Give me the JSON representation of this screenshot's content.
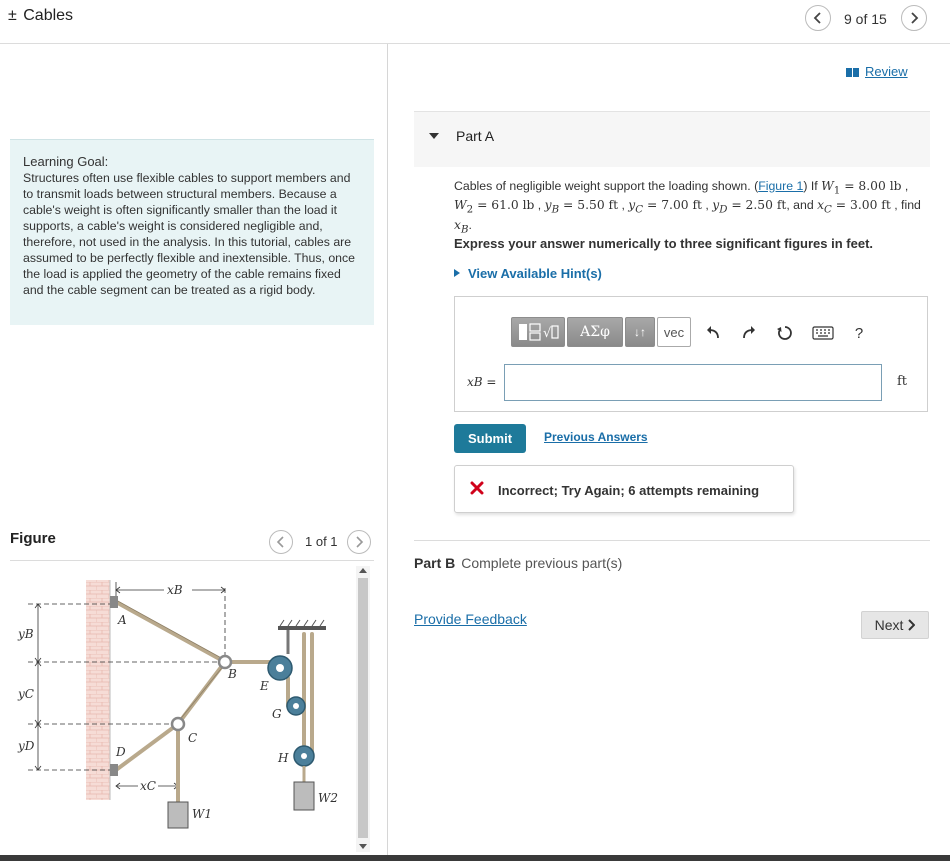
{
  "header": {
    "title_prefix": "±",
    "title": "Cables",
    "page_count": "9 of 15"
  },
  "review": {
    "label": "Review"
  },
  "learning_goal": {
    "heading": "Learning Goal:",
    "text": "Structures often use flexible cables to support members and to transmit loads between structural members. Because a cable's weight is often significantly smaller than the load it supports, a cable's weight is considered negligible and, therefore, not used in the analysis. In this tutorial, cables are assumed to be perfectly flexible and inextensible. Thus, once the load is applied the geometry of the cable remains fixed and the cable segment can be treated as a rigid body."
  },
  "figure": {
    "label": "Figure",
    "count": "1 of 1",
    "labels": {
      "A": "A",
      "B": "B",
      "C": "C",
      "D": "D",
      "E": "E",
      "G": "G",
      "H": "H",
      "xB": "xB",
      "xC": "xC",
      "yB": "yB",
      "yC": "yC",
      "yD": "yD",
      "W1": "W1",
      "W2": "W2"
    }
  },
  "partA": {
    "label": "Part A",
    "question": {
      "pre": "Cables of negligible weight support the loading shown. (",
      "link": "Figure 1",
      "post": ") If",
      "w1_sym": "W",
      "w1_sub": "1",
      "w1_val": " = 8.00 lb",
      "w2_sym": "W",
      "w2_sub": "2",
      "w2_val": " = 61.0 lb",
      "yb_sym": "y",
      "yb_sub": "B",
      "yb_val": " = 5.50 ft",
      "yc_sym": "y",
      "yc_sub": "C",
      "yc_val": " = 7.00 ft",
      "yd_sym": "y",
      "yd_sub": "D",
      "yd_val": " = 2.50 ft",
      "and": ", and",
      "xc_sym": "x",
      "xc_sub": "C",
      "xc_val": " = 3.00 ft",
      "find": "find",
      "xb_sym": "x",
      "xb_sub": "B",
      "end": "."
    },
    "instruction": "Express your answer numerically to three significant figures in feet.",
    "hints": "View Available Hint(s)",
    "toolbar": {
      "sqrt": "√",
      "greek": "ΑΣφ",
      "arrows": "↓↑",
      "vec": "vec",
      "help": "?"
    },
    "variable_label": "xB =",
    "answer_value": "",
    "unit": "ft",
    "submit": "Submit",
    "previous_answers": "Previous Answers",
    "feedback": "Incorrect; Try Again; 6 attempts remaining"
  },
  "partB": {
    "label": "Part B",
    "status": "Complete previous part(s)"
  },
  "provide_feedback": "Provide Feedback",
  "next": "Next",
  "colors": {
    "link": "#1a6ea8",
    "submit": "#1e7a9a",
    "goal_bg": "#e8f4f5",
    "error": "#d0021b"
  }
}
